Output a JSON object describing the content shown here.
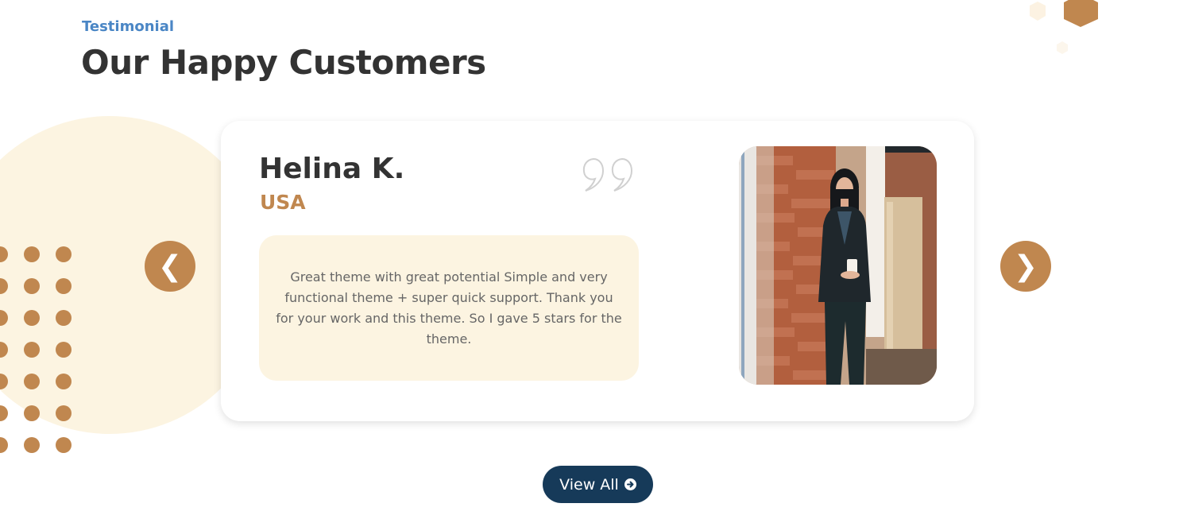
{
  "section": {
    "eyebrow": "Testimonial",
    "title": "Our Happy Customers"
  },
  "testimonial": {
    "name": "Helina K.",
    "country": "USA",
    "quote": "Great theme with great potential Simple and very functional theme + super quick support. Thank you for your work and this theme. So I gave 5 stars for the theme.",
    "quote_icon": "quote-mark-icon",
    "photo_alt": "photo of a woman holding a mug in front of a brick wall"
  },
  "carousel": {
    "prev_label": "❮",
    "next_label": "❯"
  },
  "cta": {
    "label": "View All",
    "icon": "arrow-circle-right-icon"
  },
  "colors": {
    "accent": "#c0874f",
    "accent_light": "#fcf4e1",
    "eyebrow": "#4a86c5",
    "heading": "#333333",
    "button_bg": "#163a59"
  }
}
